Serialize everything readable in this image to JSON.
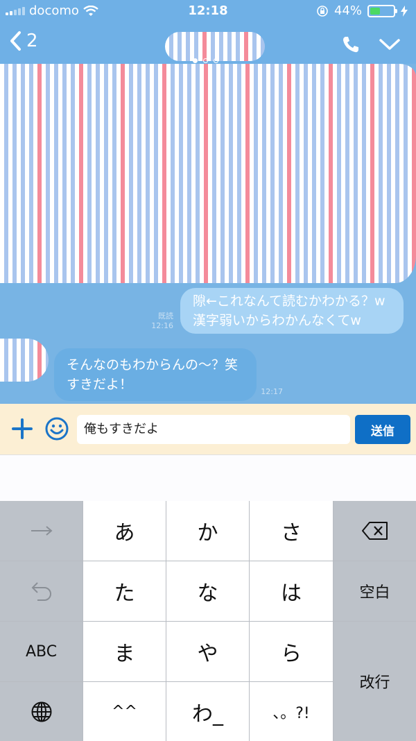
{
  "status_bar": {
    "carrier": "docomo",
    "time": "12:18",
    "battery_percent": "44%",
    "battery_level": 0.44,
    "battery_color": "#4cd964"
  },
  "header": {
    "back_count": "2",
    "icons": [
      "back-chevron-icon",
      "phone-icon",
      "chevron-down-icon"
    ],
    "page_dots": 3,
    "active_dot": 1
  },
  "messages": [
    {
      "sender": "me",
      "lines": [
        "隙←これなんて読むかわかる？w",
        "漢字弱いからわかんなくてw"
      ],
      "read_label": "既読",
      "time": "12:16"
    },
    {
      "sender": "them",
      "lines": [
        "そんなのもわからんの～？笑",
        "すきだよ！"
      ],
      "time": "12:17"
    }
  ],
  "input_bar": {
    "text": "俺もすきだよ",
    "send_label": "送信",
    "colors": {
      "bar": "#fcefd4",
      "send": "#0f6fc6",
      "icon": "#1a74c8"
    }
  },
  "keyboard": {
    "left_keys": [
      "→",
      "↶",
      "ABC",
      "globe-icon"
    ],
    "kana_rows": [
      [
        "あ",
        "か",
        "さ"
      ],
      [
        "た",
        "な",
        "は"
      ],
      [
        "ま",
        "や",
        "ら"
      ],
      [
        "^^",
        "わ_",
        "、。?!"
      ]
    ],
    "right_keys": {
      "delete": "delete-icon",
      "space": "空白",
      "return": "改行"
    }
  }
}
